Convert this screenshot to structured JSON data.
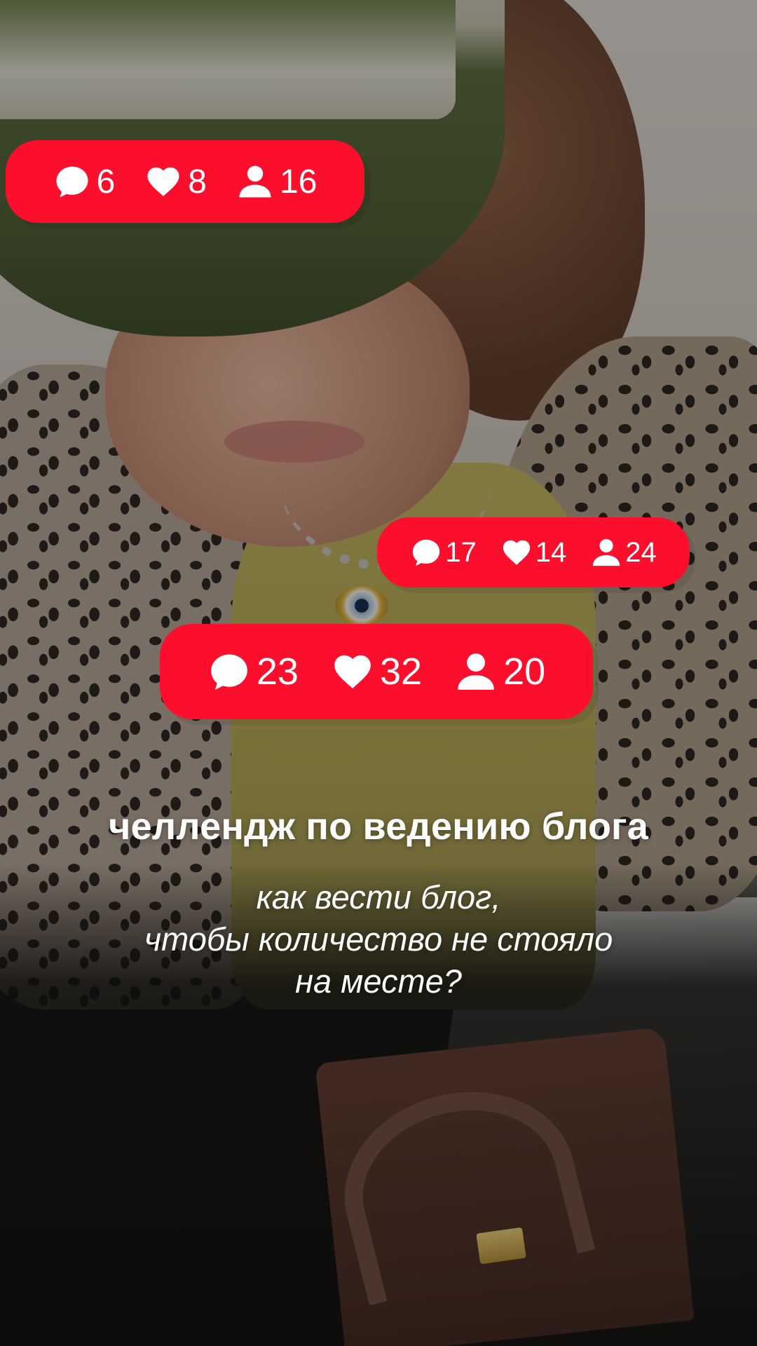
{
  "story": {
    "notifications": [
      {
        "comments": "6",
        "likes": "8",
        "followers": "16"
      },
      {
        "comments": "17",
        "likes": "14",
        "followers": "24"
      },
      {
        "comments": "23",
        "likes": "32",
        "followers": "20"
      }
    ],
    "title": "челлендж по ведению блога",
    "subtitle_lines": [
      "как вести блог,",
      "чтобы количество не стояло",
      "на месте?"
    ]
  },
  "icons": {
    "comments": "comment-bubble-icon",
    "likes": "heart-icon",
    "followers": "person-icon"
  },
  "colors": {
    "notification": "#fb0f2d",
    "text": "#ffffff"
  }
}
